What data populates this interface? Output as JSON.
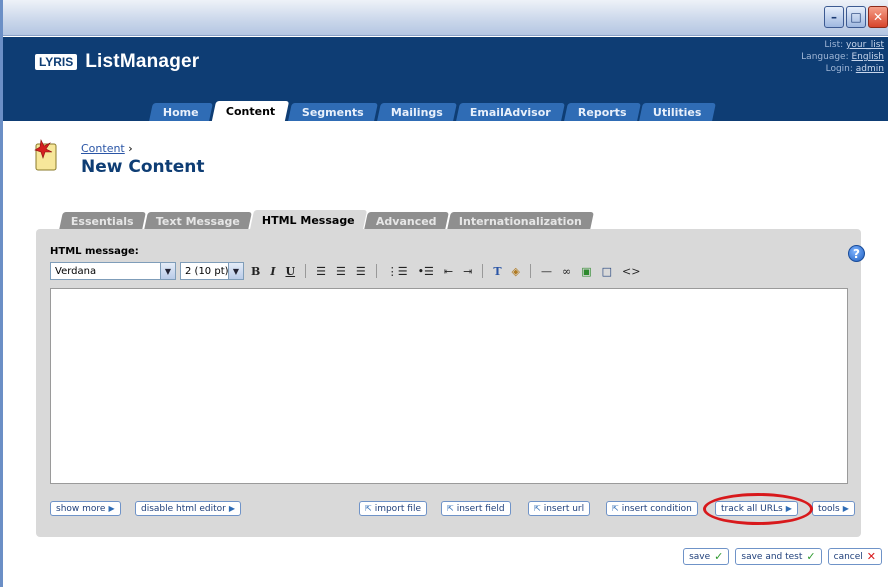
{
  "window": {
    "controls": [
      "minimize-icon",
      "maximize-icon",
      "close-icon"
    ]
  },
  "header": {
    "logo_box": "LYRIS",
    "logo_text": "ListManager",
    "list_label": "List:",
    "list_value": "your_list",
    "language_label": "Language:",
    "language_value": "English",
    "login_label": "Login:",
    "login_value": "admin"
  },
  "nav": {
    "tabs": [
      {
        "label": "Home"
      },
      {
        "label": "Content"
      },
      {
        "label": "Segments"
      },
      {
        "label": "Mailings"
      },
      {
        "label": "EmailAdvisor"
      },
      {
        "label": "Reports"
      },
      {
        "label": "Utilities"
      }
    ],
    "active": "Content"
  },
  "page": {
    "breadcrumb": "Content",
    "breadcrumb_sep": "›",
    "title": "New Content"
  },
  "content_tabs": {
    "tabs": [
      {
        "label": "Essentials"
      },
      {
        "label": "Text Message"
      },
      {
        "label": "HTML Message"
      },
      {
        "label": "Advanced"
      },
      {
        "label": "Internationalization"
      }
    ],
    "active": "HTML Message"
  },
  "editor": {
    "label": "HTML message:",
    "font_select": "Verdana",
    "size_select": "2 (10 pt)",
    "body_value": ""
  },
  "editor_buttons": {
    "show_more": "show more",
    "disable_html_editor": "disable html editor",
    "import_file": "import file",
    "insert_field": "insert field",
    "insert_url": "insert url",
    "insert_condition": "insert condition",
    "track_all_urls": "track all URLs",
    "tools": "tools"
  },
  "footer": {
    "save": "save",
    "save_and_test": "save and test",
    "cancel": "cancel"
  },
  "colors": {
    "header_bg": "#0e3d74",
    "tab_blue": "#2f6cb5",
    "highlight_circle": "#d8191c"
  }
}
